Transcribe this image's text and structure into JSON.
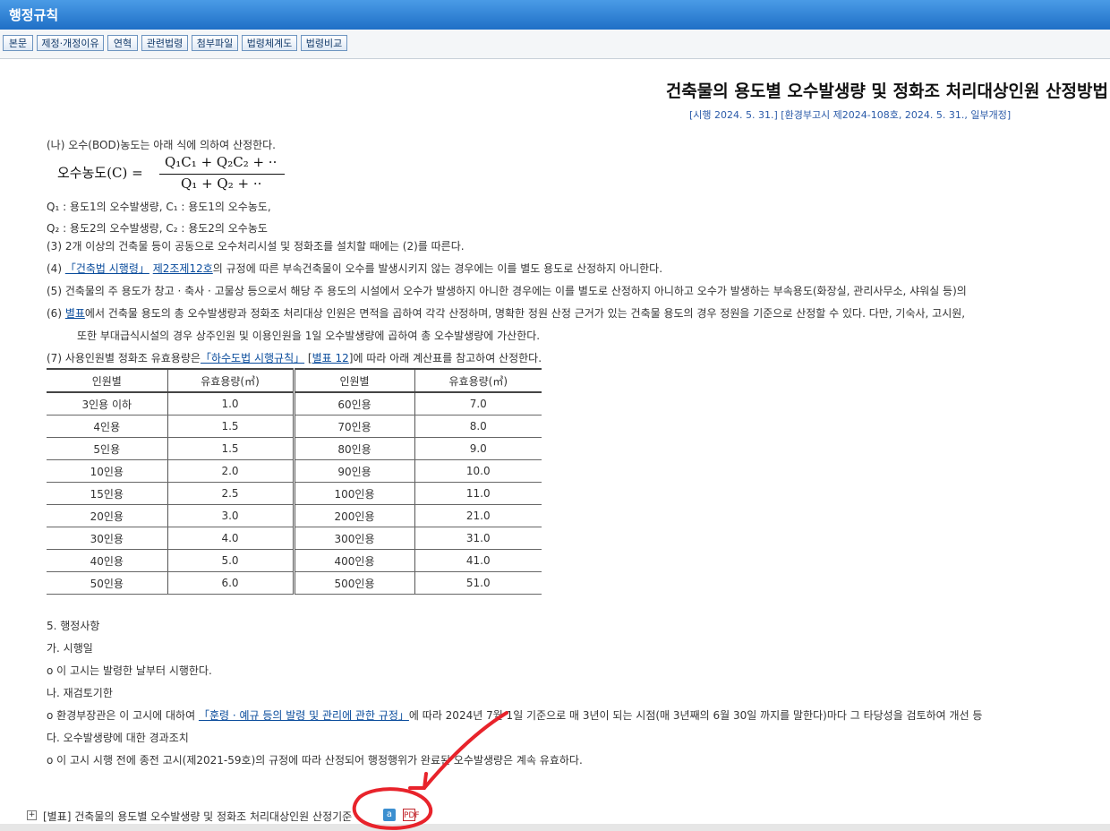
{
  "header": {
    "title": "행정규칙"
  },
  "toolbar": {
    "buttons": [
      "본문",
      "제정·개정이유",
      "연혁",
      "관련법령",
      "첨부파일",
      "법령체계도",
      "법령비교"
    ]
  },
  "document": {
    "title": "건축물의 용도별 오수발생량 및 정화조 처리대상인원 산정방법",
    "meta": "[시행 2024. 5. 31.] [환경부고시 제2024-108호, 2024. 5. 31., 일부개정]"
  },
  "body": {
    "p_na": "(나) 오수(BOD)농도는 아래 식에 의하여 산정한다.",
    "formula_lhs": "오수농도(C) =",
    "formula_num": "Q₁C₁ + Q₂C₂ + ··",
    "formula_den": "Q₁ + Q₂ + ··",
    "q1_line": "Q₁ : 용도1의  오수발생량,  C₁ : 용도1의  오수농도,",
    "q2_line": "Q₂ : 용도2의  오수발생량,  C₂ : 용도2의  오수농도",
    "p3": "(3) 2개 이상의 건축물 등이 공동으로 오수처리시설 및 정화조를 설치할 때에는 (2)를 따른다.",
    "p4_pre": "(4) ",
    "p4_link1": "「건축법 시행령」",
    "p4_link2": "제2조제12호",
    "p4_post": "의 규정에 따른 부속건축물이 오수를 발생시키지 않는 경우에는 이를 별도 용도로 산정하지 아니한다.",
    "p5": "(5) 건축물의 주 용도가 창고 · 축사 · 고물상 등으로서 해당 주 용도의 시설에서 오수가 발생하지 아니한 경우에는 이를 별도로 산정하지 아니하고 오수가 발생하는 부속용도(화장실, 관리사무소, 샤워실 등)의",
    "p6_pre": "(6) ",
    "p6_link": "별표",
    "p6_post": "에서 건축물 용도의 총 오수발생량과 정화조 처리대상 인원은 면적을 곱하여 각각 산정하며, 명확한 정원 산정 근거가 있는 건축물 용도의 경우 정원을 기준으로 산정할 수 있다. 다만, 기숙사, 고시원,",
    "p6_cont": "또한 부대급식시설의 경우 상주인원 및 이용인원을 1일 오수발생량에 곱하여 총 오수발생량에 가산한다.",
    "p7_pre": "(7) 사용인원별 정화조 유효용량은",
    "p7_link1": "「하수도법 시행규칙」",
    "p7_mid": " [",
    "p7_link2": "별표 12",
    "p7_post": "]에 따라 아래 계산표를 참고하여 산정한다."
  },
  "table": {
    "headers": [
      "인원별",
      "유효용량(㎥)",
      "인원별",
      "유효용량(㎥)"
    ],
    "rows": [
      [
        "3인용 이하",
        "1.0",
        "60인용",
        "7.0"
      ],
      [
        "4인용",
        "1.5",
        "70인용",
        "8.0"
      ],
      [
        "5인용",
        "1.5",
        "80인용",
        "9.0"
      ],
      [
        "10인용",
        "2.0",
        "90인용",
        "10.0"
      ],
      [
        "15인용",
        "2.5",
        "100인용",
        "11.0"
      ],
      [
        "20인용",
        "3.0",
        "200인용",
        "21.0"
      ],
      [
        "30인용",
        "4.0",
        "300인용",
        "31.0"
      ],
      [
        "40인용",
        "5.0",
        "400인용",
        "41.0"
      ],
      [
        "50인용",
        "6.0",
        "500인용",
        "51.0"
      ]
    ]
  },
  "section5": {
    "heading": "5. 행정사항",
    "ga": "가. 시행일",
    "ga_text": "o 이 고시는 발령한 날부터 시행한다.",
    "na": "나. 재검토기한",
    "na_pre": "o 환경부장관은 이 고시에 대하여 ",
    "na_link": "「훈령 · 예규 등의 발령 및 관리에 관한 규정」",
    "na_post": "에 따라 2024년 7월 1일 기준으로 매 3년이 되는 시점(매 3년째의 6월 30일 까지를 말한다)마다 그 타당성을 검토하여 개선 등",
    "da": "다. 오수발생량에 대한 경과조치",
    "da_text": "o 이 고시 시행 전에 종전 고시(제2021-59호)의 규정에 따라 산정되어 행정행위가 완료된 오수발생량은 계속 유효하다."
  },
  "attachment": {
    "label": "[별표] 건축물의 용도별 오수발생량 및 정화조 처리대상인원 산정기준",
    "hwp_icon_text": "a",
    "pdf_icon_text": "PDF"
  },
  "annotation_color": "#e8232b"
}
